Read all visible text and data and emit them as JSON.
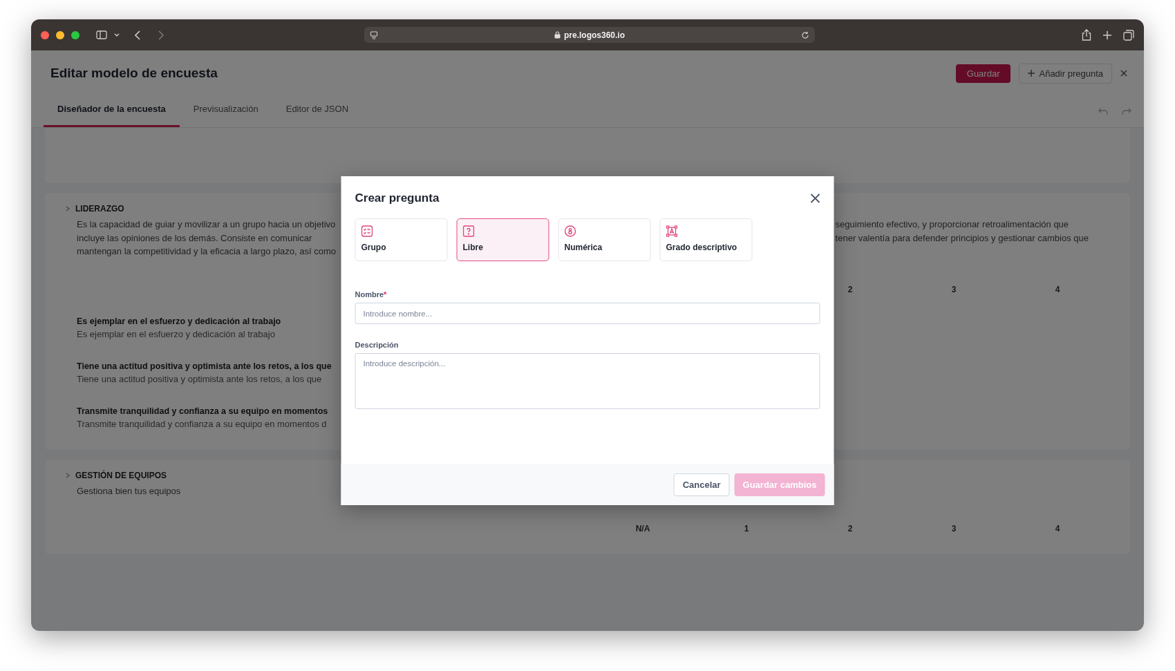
{
  "browser": {
    "url": "pre.logos360.io"
  },
  "page": {
    "title": "Editar modelo de encuesta",
    "buttons": [
      {
        "label": "Guardar",
        "kind": "primary"
      },
      {
        "label": "Añadir pregunta",
        "kind": "add"
      }
    ],
    "tabs": [
      {
        "label": "Diseñador de la encuesta",
        "selected": true
      },
      {
        "label": "Previsualización",
        "selected": false
      },
      {
        "label": "Editor de JSON",
        "selected": false
      }
    ],
    "sections": [
      {
        "title": "LIDERAZGO",
        "description_lines": [
          "Es la capacidad de guiar y movilizar a un grupo hacia un objetivo",
          "incluye las opiniones de los demás. Consiste en comunicar",
          "mantengan la competitividad y la eficacia a largo plazo, así como"
        ],
        "description_right": [
          "seguimiento efectivo, y proporcionar retroalimentación que",
          "tener valentía para defender principios y gestionar cambios que"
        ],
        "scale": [
          "2",
          "3",
          "4"
        ],
        "questions": [
          {
            "title": "Es ejemplar en el esfuerzo y dedicación al trabajo",
            "subtitle": "Es ejemplar en el esfuerzo y dedicación al trabajo"
          },
          {
            "title": "Tiene una actitud positiva y optimista ante los retos, a los que",
            "subtitle": "Tiene una actitud positiva y optimista ante los retos, a los que"
          },
          {
            "title": "Transmite tranquilidad y confianza a su equipo en momentos",
            "subtitle": "Transmite tranquilidad y confianza a su equipo en momentos d"
          }
        ]
      },
      {
        "title": "GESTIÓN DE EQUIPOS",
        "description_lines": [
          "Gestiona bien tus equipos"
        ],
        "scale": [
          "N/A",
          "1",
          "2",
          "3",
          "4"
        ]
      }
    ]
  },
  "dialog": {
    "title": "Crear pregunta",
    "types": [
      {
        "label": "Grupo",
        "kind": "group",
        "selected": false
      },
      {
        "label": "Libre",
        "kind": "free",
        "selected": true
      },
      {
        "label": "Numérica",
        "kind": "numeric",
        "selected": false
      },
      {
        "label": "Grado descriptivo",
        "kind": "descriptive",
        "selected": false
      }
    ],
    "fields": [
      {
        "label": "Nombre",
        "required_mark": "*",
        "placeholder": "Introduce nombre...",
        "kind": "input"
      },
      {
        "label": "Descripción",
        "placeholder": "Introduce descripción...",
        "kind": "textarea"
      }
    ],
    "buttons": [
      {
        "label": "Cancelar",
        "kind": "secondary"
      },
      {
        "label": "Guardar cambios",
        "kind": "primary",
        "disabled": true
      }
    ]
  }
}
